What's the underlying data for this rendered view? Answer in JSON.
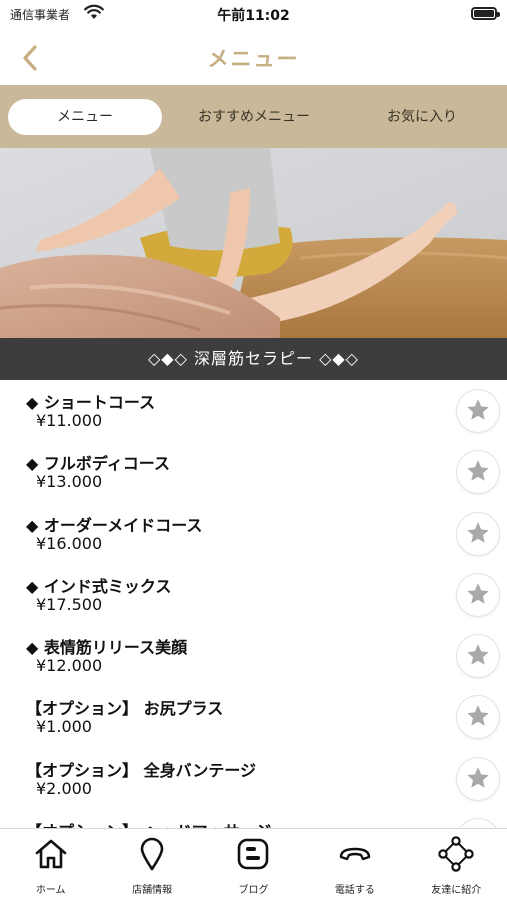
{
  "status_bar": {
    "carrier": "通信事業者",
    "time": "午前11:02",
    "wifi_icon": "wifi-icon",
    "battery_icon": "battery-icon"
  },
  "nav": {
    "title": "メニュー",
    "back_icon": "chevron-left-icon"
  },
  "tabs": [
    {
      "label": "メニュー",
      "active": true
    },
    {
      "label": "おすすめメニュー",
      "active": false
    },
    {
      "label": "お気に入り",
      "active": false
    }
  ],
  "hero": {
    "image": "massage-therapy-photo",
    "banner": "◇◆◇ 深層筋セラピー ◇◆◇"
  },
  "menu_items": [
    {
      "name": "◆ ショートコース",
      "price": "¥11.000"
    },
    {
      "name": "◆ フルボディコース",
      "price": "¥13.000"
    },
    {
      "name": "◆ オーダーメイドコース",
      "price": "¥16.000"
    },
    {
      "name": "◆ インド式ミックス",
      "price": "¥17.500"
    },
    {
      "name": "◆ 表情筋リリース美顔",
      "price": "¥12.000"
    },
    {
      "name": "【オプション】 お尻プラス",
      "price": "¥1.000"
    },
    {
      "name": "【オプション】 全身バンテージ",
      "price": "¥2.000"
    },
    {
      "name": "【オプション】 ヘッドマッサージ",
      "price": ""
    }
  ],
  "bottom_nav": [
    {
      "label": "ホーム",
      "icon": "home-icon"
    },
    {
      "label": "店舗情報",
      "icon": "map-pin-icon"
    },
    {
      "label": "ブログ",
      "icon": "blog-icon"
    },
    {
      "label": "電話する",
      "icon": "phone-icon"
    },
    {
      "label": "友達に紹介",
      "icon": "share-icon"
    }
  ],
  "colors": {
    "accent": "#c5ae82",
    "tab_bar": "#c9b99a",
    "banner": "#3d3d3d",
    "star": "#a9a9a9"
  }
}
